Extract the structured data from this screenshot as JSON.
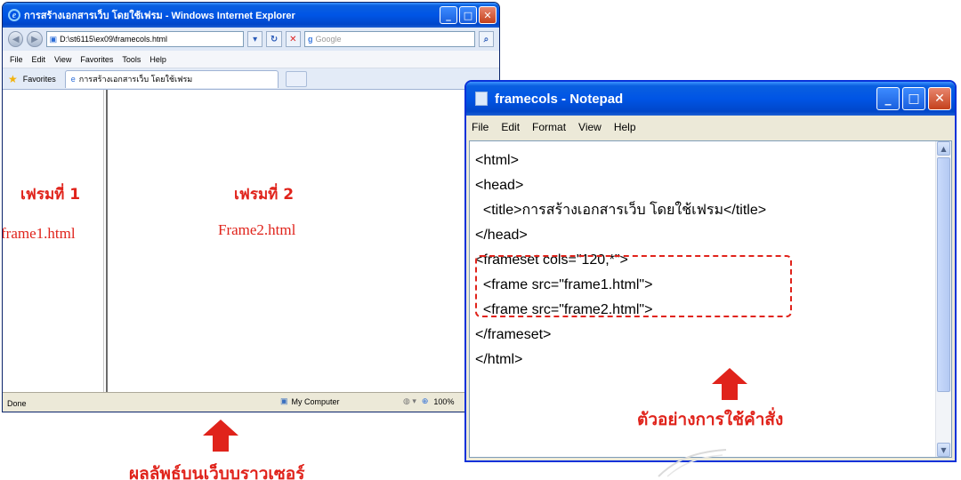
{
  "ie": {
    "title": "การสร้างเอกสารเว็บ โดยใช้เฟรม - Windows Internet Explorer",
    "address": "D:\\st6115\\ex09\\framecols.html",
    "search_placeholder": "Google",
    "menu": [
      "File",
      "Edit",
      "View",
      "Favorites",
      "Tools",
      "Help"
    ],
    "favorites_label": "Favorites",
    "tab_title": "การสร้างเอกสารเว็บ โดยใช้เฟรม",
    "frame1": {
      "heading": "เฟรมที่ 1",
      "file": "frame1.html"
    },
    "frame2": {
      "heading": "เฟรมที่ 2",
      "file": "Frame2.html"
    },
    "status": {
      "text": "Done",
      "zone": "My Computer",
      "zoom": "100%"
    }
  },
  "notepad": {
    "title": "framecols - Notepad",
    "menu": [
      "File",
      "Edit",
      "Format",
      "View",
      "Help"
    ],
    "lines": [
      "<html>",
      "<head>",
      "  <title>การสร้างเอกสารเว็บ โดยใช้เฟรม</title>",
      "</head>",
      "<frameset cols=\"120,*\">",
      "  <frame src=\"frame1.html\">",
      "  <frame src=\"frame2.html\">",
      "</frameset>",
      "</html>"
    ]
  },
  "captions": {
    "browser_result": "ผลลัพธ์บนเว็บบราวเซอร์",
    "command_example": "ตัวอย่างการใช้คำสั่ง"
  },
  "colors": {
    "accent": "#e0231b",
    "xp_blue": "#0055e5"
  }
}
